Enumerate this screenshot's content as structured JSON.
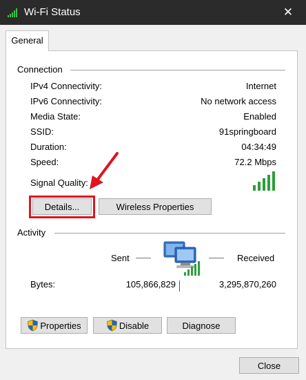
{
  "window": {
    "title": "Wi-Fi Status",
    "close_glyph": "✕"
  },
  "tabs": [
    {
      "label": "General"
    }
  ],
  "connection": {
    "group_label": "Connection",
    "rows": [
      {
        "label": "IPv4 Connectivity:",
        "value": "Internet"
      },
      {
        "label": "IPv6 Connectivity:",
        "value": "No network access"
      },
      {
        "label": "Media State:",
        "value": "Enabled"
      },
      {
        "label": "SSID:",
        "value": "91springboard"
      },
      {
        "label": "Duration:",
        "value": "04:34:49"
      },
      {
        "label": "Speed:",
        "value": "72.2 Mbps"
      }
    ],
    "signal_quality_label": "Signal Quality:",
    "signal_bars": 5,
    "details_button": "Details...",
    "wireless_properties_button": "Wireless Properties"
  },
  "activity": {
    "group_label": "Activity",
    "sent_label": "Sent",
    "received_label": "Received",
    "bytes_label": "Bytes:",
    "bytes_sent": "105,866,829",
    "bytes_received": "3,295,870,260"
  },
  "buttons": {
    "properties": "Properties",
    "disable": "Disable",
    "diagnose": "Diagnose",
    "close": "Close"
  },
  "icons": {
    "title_icon": "wifi-signal-icon",
    "shield": "uac-shield-icon",
    "network": "network-computers-icon",
    "annotation": "red-arrow-annotation"
  },
  "colors": {
    "titlebar": "#2b2b2b",
    "signal_green": "#2e9e3a",
    "annotation_red": "#e0141e"
  }
}
